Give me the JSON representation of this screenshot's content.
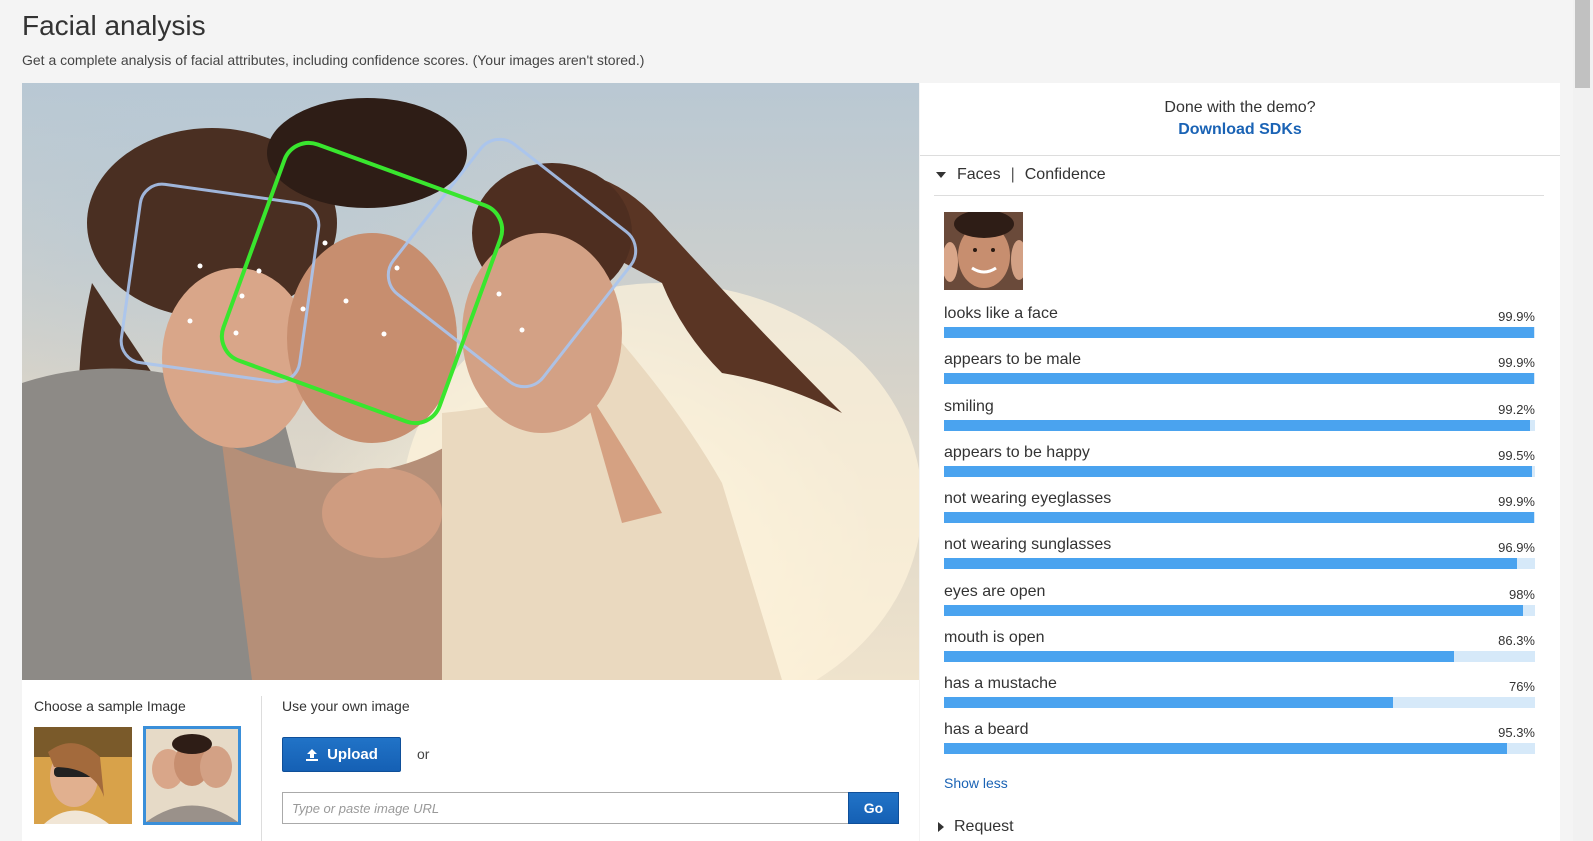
{
  "page": {
    "title": "Facial analysis",
    "subtitle": "Get a complete analysis of facial attributes, including confidence scores. (Your images aren't stored.)"
  },
  "samples": {
    "label": "Choose a sample Image"
  },
  "own_image": {
    "label": "Use your own image",
    "upload_label": "Upload",
    "or_label": "or",
    "url_placeholder": "Type or paste image URL",
    "go_label": "Go"
  },
  "right_panel": {
    "demo_text": "Done with the demo?",
    "download_label": "Download SDKs",
    "section_faces": "Faces",
    "section_confidence": "Confidence",
    "show_less": "Show less",
    "request_label": "Request"
  },
  "attributes": [
    {
      "label": "looks like a face",
      "percent_text": "99.9%",
      "value": 99.9
    },
    {
      "label": "appears to be male",
      "percent_text": "99.9%",
      "value": 99.9
    },
    {
      "label": "smiling",
      "percent_text": "99.2%",
      "value": 99.2
    },
    {
      "label": "appears to be happy",
      "percent_text": "99.5%",
      "value": 99.5
    },
    {
      "label": "not wearing eyeglasses",
      "percent_text": "99.9%",
      "value": 99.9
    },
    {
      "label": "not wearing sunglasses",
      "percent_text": "96.9%",
      "value": 96.9
    },
    {
      "label": "eyes are open",
      "percent_text": "98%",
      "value": 98
    },
    {
      "label": "mouth is open",
      "percent_text": "86.3%",
      "value": 86.3
    },
    {
      "label": "has a mustache",
      "percent_text": "76%",
      "value": 76
    },
    {
      "label": "has a beard",
      "percent_text": "95.3%",
      "value": 95.3
    }
  ],
  "colors": {
    "accent": "#1a63b5",
    "bar_fill": "#4aa3ef",
    "bar_track": "#d6e9f9",
    "selected_face_box": "#39e62e",
    "other_face_box": "#a9c4ee"
  }
}
